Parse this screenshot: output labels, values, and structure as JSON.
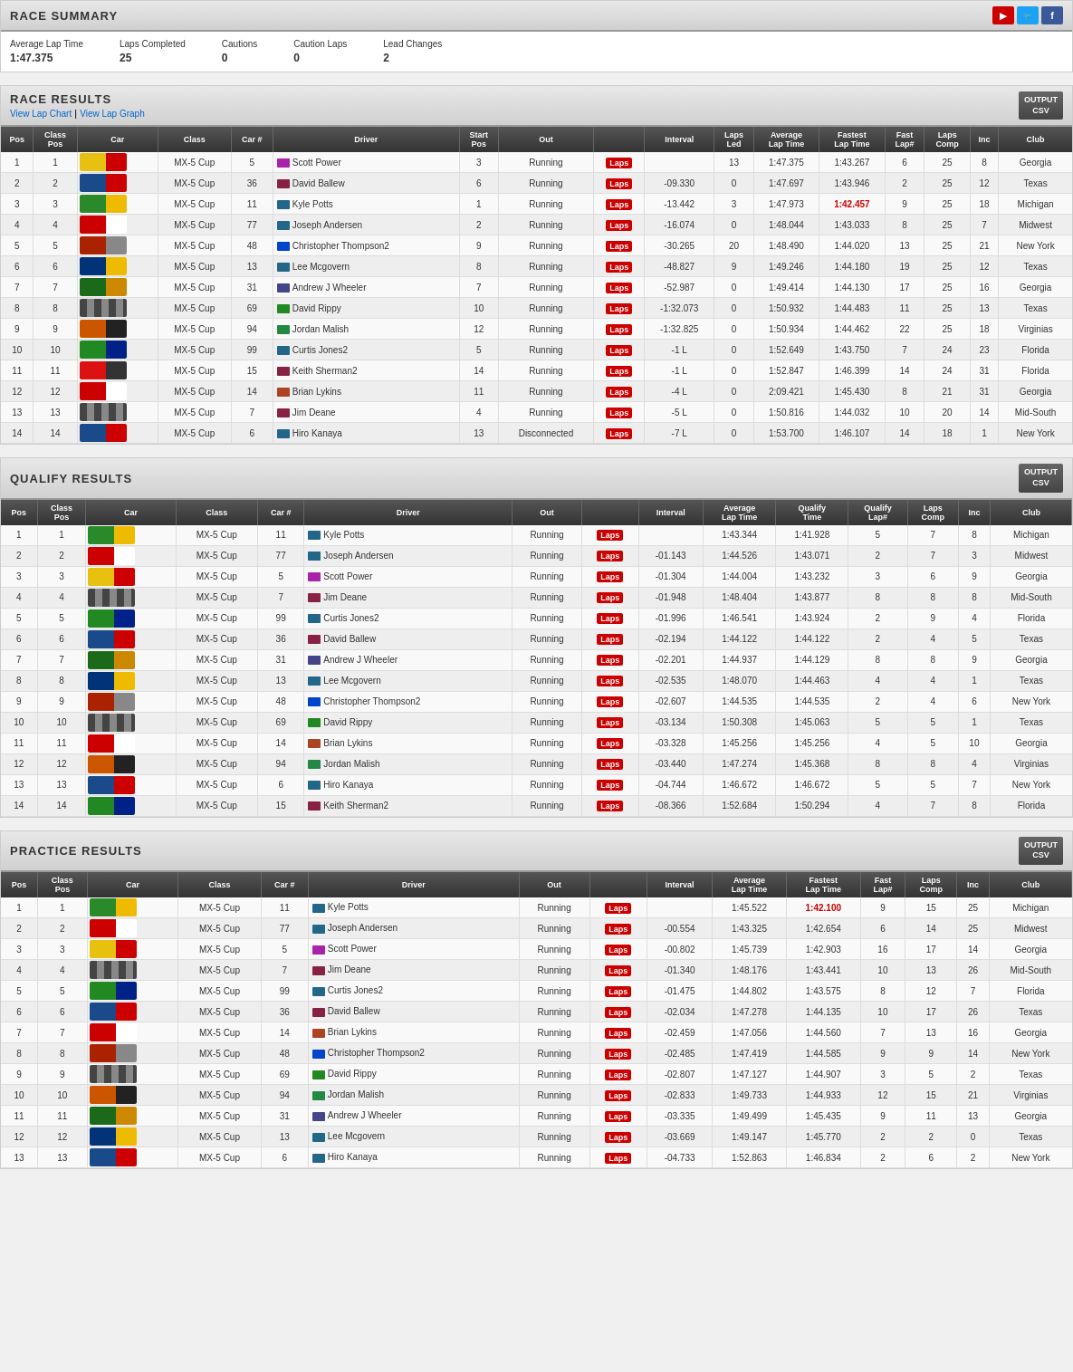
{
  "raceSummary": {
    "title": "RACE SUMMARY",
    "stats": [
      {
        "label": "Average Lap Time",
        "value": "1:47.375"
      },
      {
        "label": "Laps Completed",
        "value": "25"
      },
      {
        "label": "Cautions",
        "value": "0"
      },
      {
        "label": "Caution Laps",
        "value": "0"
      },
      {
        "label": "Lead Changes",
        "value": "2"
      }
    ]
  },
  "raceResults": {
    "title": "RACE RESULTS",
    "linkChart": "View Lap Chart",
    "linkGraph": "View Lap Graph",
    "columns": [
      "Pos",
      "Class Pos",
      "Car",
      "Class",
      "Car #",
      "Driver",
      "Start Pos",
      "Out",
      "",
      "Interval",
      "Laps Led",
      "Average Lap Time",
      "Fastest Lap Time",
      "Fast Lap#",
      "Laps Comp",
      "Inc",
      "Club"
    ],
    "rows": [
      [
        1,
        1,
        "yellow",
        "MX-5 Cup",
        5,
        "Scott Power",
        3,
        "Running",
        "Laps",
        "",
        13,
        "1:47.375",
        "1:43.267",
        6,
        25,
        8,
        "Georgia"
      ],
      [
        2,
        2,
        "blue",
        "MX-5 Cup",
        36,
        "David Ballew",
        6,
        "Running",
        "Laps",
        "-09.330",
        0,
        "1:47.697",
        "1:43.946",
        2,
        25,
        12,
        "Texas"
      ],
      [
        3,
        3,
        "green",
        "MX-5 Cup",
        11,
        "Kyle Potts",
        1,
        "Running",
        "Laps",
        "-13.442",
        3,
        "1:47.973",
        "1:42.457",
        9,
        25,
        18,
        "Michigan"
      ],
      [
        4,
        4,
        "red",
        "MX-5 Cup",
        77,
        "Joseph Andersen",
        2,
        "Running",
        "Laps",
        "-16.074",
        0,
        "1:48.044",
        "1:43.033",
        8,
        25,
        7,
        "Midwest"
      ],
      [
        5,
        5,
        "red2",
        "MX-5 Cup",
        48,
        "Christopher Thompson2",
        9,
        "Running",
        "Laps",
        "-30.265",
        20,
        "1:48.490",
        "1:44.020",
        13,
        25,
        21,
        "New York"
      ],
      [
        6,
        6,
        "darkblue",
        "MX-5 Cup",
        13,
        "Lee Mcgovern",
        8,
        "Running",
        "Laps",
        "-48.827",
        9,
        "1:49.246",
        "1:44.180",
        19,
        25,
        12,
        "Texas"
      ],
      [
        7,
        7,
        "green2",
        "MX-5 Cup",
        31,
        "Andrew J Wheeler",
        7,
        "Running",
        "Laps",
        "-52.987",
        0,
        "1:49.414",
        "1:44.130",
        17,
        25,
        16,
        "Georgia"
      ],
      [
        8,
        8,
        "stripe",
        "MX-5 Cup",
        69,
        "David Rippy",
        10,
        "Running",
        "Laps",
        "-1:32.073",
        0,
        "1:50.932",
        "1:44.483",
        11,
        25,
        13,
        "Texas"
      ],
      [
        9,
        9,
        "orange",
        "MX-5 Cup",
        94,
        "Jordan Malish",
        12,
        "Running",
        "Laps",
        "-1:32.825",
        0,
        "1:50.934",
        "1:44.462",
        22,
        25,
        18,
        "Virginias"
      ],
      [
        10,
        10,
        "green3",
        "MX-5 Cup",
        99,
        "Curtis Jones2",
        5,
        "Running",
        "Laps",
        "-1 L",
        0,
        "1:52.649",
        "1:43.750",
        7,
        24,
        23,
        "Florida"
      ],
      [
        11,
        11,
        "red3",
        "MX-5 Cup",
        15,
        "Keith Sherman2",
        14,
        "Running",
        "Laps",
        "-1 L",
        0,
        "1:52.847",
        "1:46.399",
        14,
        24,
        31,
        "Florida"
      ],
      [
        12,
        12,
        "red",
        "MX-5 Cup",
        14,
        "Brian Lykins",
        11,
        "Running",
        "Laps",
        "-4 L",
        0,
        "2:09.421",
        "1:45.430",
        8,
        21,
        31,
        "Georgia"
      ],
      [
        13,
        13,
        "stripe",
        "MX-5 Cup",
        7,
        "Jim Deane",
        4,
        "Running",
        "Laps",
        "-5 L",
        0,
        "1:50.816",
        "1:44.032",
        10,
        20,
        14,
        "Mid-South"
      ],
      [
        14,
        14,
        "blue",
        "MX-5 Cup",
        6,
        "Hiro Kanaya",
        13,
        "Disconnected",
        "Laps",
        "-7 L",
        0,
        "1:53.700",
        "1:46.107",
        14,
        18,
        1,
        "New York"
      ]
    ],
    "fastestRow": 3
  },
  "qualifyResults": {
    "title": "QUALIFY RESULTS",
    "columns": [
      "Pos",
      "Class Pos",
      "Car",
      "Class",
      "Car #",
      "Driver",
      "Out",
      "",
      "Interval",
      "Average Lap Time",
      "Qualify Time",
      "Qualify Lap#",
      "Laps Comp",
      "Inc",
      "Club"
    ],
    "rows": [
      [
        1,
        1,
        "green",
        "MX-5 Cup",
        11,
        "Kyle Potts",
        "Running",
        "Laps",
        "",
        "1:43.344",
        "1:41.928",
        5,
        7,
        8,
        "Michigan"
      ],
      [
        2,
        2,
        "red",
        "MX-5 Cup",
        77,
        "Joseph Andersen",
        "Running",
        "Laps",
        "-01.143",
        "1:44.526",
        "1:43.071",
        2,
        7,
        3,
        "Midwest"
      ],
      [
        3,
        3,
        "yellow",
        "MX-5 Cup",
        5,
        "Scott Power",
        "Running",
        "Laps",
        "-01.304",
        "1:44.004",
        "1:43.232",
        3,
        6,
        9,
        "Georgia"
      ],
      [
        4,
        4,
        "stripe",
        "MX-5 Cup",
        7,
        "Jim Deane",
        "Running",
        "Laps",
        "-01.948",
        "1:48.404",
        "1:43.877",
        8,
        8,
        8,
        "Mid-South"
      ],
      [
        5,
        5,
        "green3",
        "MX-5 Cup",
        99,
        "Curtis Jones2",
        "Running",
        "Laps",
        "-01.996",
        "1:46.541",
        "1:43.924",
        2,
        9,
        4,
        "Florida"
      ],
      [
        6,
        6,
        "blue",
        "MX-5 Cup",
        36,
        "David Ballew",
        "Running",
        "Laps",
        "-02.194",
        "1:44.122",
        "1:44.122",
        2,
        4,
        5,
        "Texas"
      ],
      [
        7,
        7,
        "green2",
        "MX-5 Cup",
        31,
        "Andrew J Wheeler",
        "Running",
        "Laps",
        "-02.201",
        "1:44.937",
        "1:44.129",
        8,
        8,
        9,
        "Georgia"
      ],
      [
        8,
        8,
        "darkblue",
        "MX-5 Cup",
        13,
        "Lee Mcgovern",
        "Running",
        "Laps",
        "-02.535",
        "1:48.070",
        "1:44.463",
        4,
        4,
        1,
        "Texas"
      ],
      [
        9,
        9,
        "red2",
        "MX-5 Cup",
        48,
        "Christopher Thompson2",
        "Running",
        "Laps",
        "-02.607",
        "1:44.535",
        "1:44.535",
        2,
        4,
        6,
        "New York"
      ],
      [
        10,
        10,
        "stripe",
        "MX-5 Cup",
        69,
        "David Rippy",
        "Running",
        "Laps",
        "-03.134",
        "1:50.308",
        "1:45.063",
        5,
        5,
        1,
        "Texas"
      ],
      [
        11,
        11,
        "red",
        "MX-5 Cup",
        14,
        "Brian Lykins",
        "Running",
        "Laps",
        "-03.328",
        "1:45.256",
        "1:45.256",
        4,
        5,
        10,
        "Georgia"
      ],
      [
        12,
        12,
        "orange",
        "MX-5 Cup",
        94,
        "Jordan Malish",
        "Running",
        "Laps",
        "-03.440",
        "1:47.274",
        "1:45.368",
        8,
        8,
        4,
        "Virginias"
      ],
      [
        13,
        13,
        "blue",
        "MX-5 Cup",
        6,
        "Hiro Kanaya",
        "Running",
        "Laps",
        "-04.744",
        "1:46.672",
        "1:46.672",
        5,
        5,
        7,
        "New York"
      ],
      [
        14,
        14,
        "green3",
        "MX-5 Cup",
        15,
        "Keith Sherman2",
        "Running",
        "Laps",
        "-08.366",
        "1:52.684",
        "1:50.294",
        4,
        7,
        8,
        "Florida"
      ]
    ]
  },
  "practiceResults": {
    "title": "PRACTICE RESULTS",
    "columns": [
      "Pos",
      "Class Pos",
      "Car",
      "Class",
      "Car #",
      "Driver",
      "Out",
      "",
      "Interval",
      "Average Lap Time",
      "Fastest Lap Time",
      "Fast Lap#",
      "Laps Comp",
      "Inc",
      "Club"
    ],
    "rows": [
      [
        1,
        1,
        "green",
        "MX-5 Cup",
        11,
        "Kyle Potts",
        "Running",
        "Laps",
        "",
        "1:45.522",
        "1:42.100",
        9,
        15,
        25,
        "Michigan"
      ],
      [
        2,
        2,
        "red",
        "MX-5 Cup",
        77,
        "Joseph Andersen",
        "Running",
        "Laps",
        "-00.554",
        "1:43.325",
        "1:42.654",
        6,
        14,
        25,
        "Midwest"
      ],
      [
        3,
        3,
        "yellow",
        "MX-5 Cup",
        5,
        "Scott Power",
        "Running",
        "Laps",
        "-00.802",
        "1:45.739",
        "1:42.903",
        16,
        17,
        14,
        "Georgia"
      ],
      [
        4,
        4,
        "stripe",
        "MX-5 Cup",
        7,
        "Jim Deane",
        "Running",
        "Laps",
        "-01.340",
        "1:48.176",
        "1:43.441",
        10,
        13,
        26,
        "Mid-South"
      ],
      [
        5,
        5,
        "green3",
        "MX-5 Cup",
        99,
        "Curtis Jones2",
        "Running",
        "Laps",
        "-01.475",
        "1:44.802",
        "1:43.575",
        8,
        12,
        7,
        "Florida"
      ],
      [
        6,
        6,
        "blue",
        "MX-5 Cup",
        36,
        "David Ballew",
        "Running",
        "Laps",
        "-02.034",
        "1:47.278",
        "1:44.135",
        10,
        17,
        26,
        "Texas"
      ],
      [
        7,
        7,
        "red",
        "MX-5 Cup",
        14,
        "Brian Lykins",
        "Running",
        "Laps",
        "-02.459",
        "1:47.056",
        "1:44.560",
        7,
        13,
        16,
        "Georgia"
      ],
      [
        8,
        8,
        "red2",
        "MX-5 Cup",
        48,
        "Christopher Thompson2",
        "Running",
        "Laps",
        "-02.485",
        "1:47.419",
        "1:44.585",
        9,
        9,
        14,
        "New York"
      ],
      [
        9,
        9,
        "stripe",
        "MX-5 Cup",
        69,
        "David Rippy",
        "Running",
        "Laps",
        "-02.807",
        "1:47.127",
        "1:44.907",
        3,
        5,
        2,
        "Texas"
      ],
      [
        10,
        10,
        "orange",
        "MX-5 Cup",
        94,
        "Jordan Malish",
        "Running",
        "Laps",
        "-02.833",
        "1:49.733",
        "1:44.933",
        12,
        15,
        21,
        "Virginias"
      ],
      [
        11,
        11,
        "green2",
        "MX-5 Cup",
        31,
        "Andrew J Wheeler",
        "Running",
        "Laps",
        "-03.335",
        "1:49.499",
        "1:45.435",
        9,
        11,
        13,
        "Georgia"
      ],
      [
        12,
        12,
        "darkblue",
        "MX-5 Cup",
        13,
        "Lee Mcgovern",
        "Running",
        "Laps",
        "-03.669",
        "1:49.147",
        "1:45.770",
        2,
        2,
        0,
        "Texas"
      ],
      [
        13,
        13,
        "blue",
        "MX-5 Cup",
        6,
        "Hiro Kanaya",
        "Running",
        "Laps",
        "-04.733",
        "1:52.863",
        "1:46.834",
        2,
        6,
        2,
        "New York"
      ]
    ],
    "fastestPractice": [
      1,
      3
    ]
  },
  "labels": {
    "viewLapChart": "View Lap Chart",
    "viewLapGraph": "View Lap Graph",
    "outputCsv": "OUTPUT\nCSV",
    "separator": "|"
  }
}
